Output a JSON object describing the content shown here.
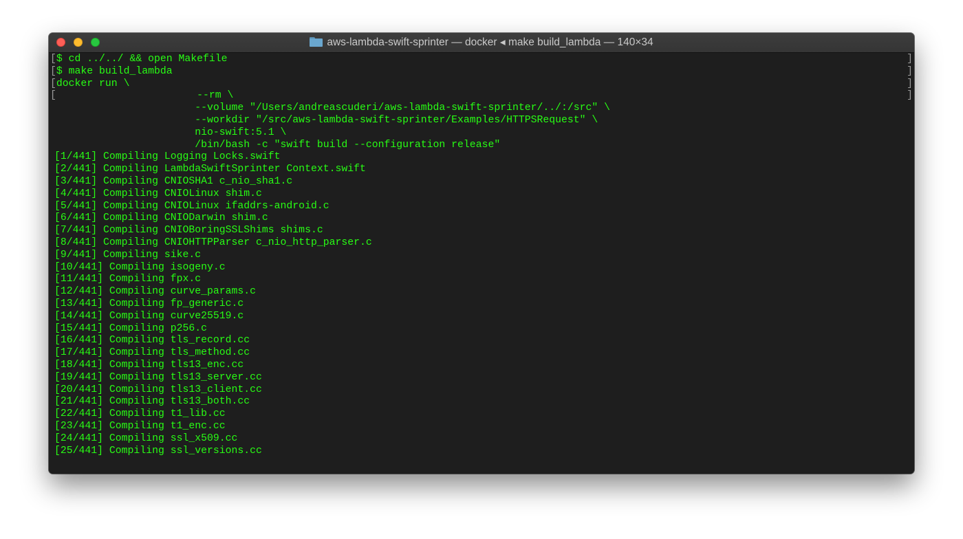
{
  "window": {
    "title": "aws-lambda-swift-sprinter — docker ◂ make build_lambda — 140×34",
    "folder_icon": "folder-icon",
    "colors": {
      "terminal_text": "#28fe14",
      "terminal_background": "#1e1e1e",
      "close": "#fe5f57",
      "minimize": "#febc2e",
      "maximize": "#28c840"
    }
  },
  "terminal": {
    "lines": [
      {
        "text": "$ cd ../../ && open Makefile",
        "bracket": true
      },
      {
        "text": "$ make build_lambda",
        "bracket": true
      },
      {
        "text": "docker run \\",
        "bracket": true
      },
      {
        "text": "                       --rm \\",
        "bracket": true
      },
      {
        "text": "                       --volume \"/Users/andreascuderi/aws-lambda-swift-sprinter/../:/src\" \\",
        "bracket": false
      },
      {
        "text": "                       --workdir \"/src/aws-lambda-swift-sprinter/Examples/HTTPSRequest\" \\",
        "bracket": false
      },
      {
        "text": "                       nio-swift:5.1 \\",
        "bracket": false
      },
      {
        "text": "                       /bin/bash -c \"swift build --configuration release\"",
        "bracket": false
      },
      {
        "text": "[1/441] Compiling Logging Locks.swift",
        "bracket": false
      },
      {
        "text": "[2/441] Compiling LambdaSwiftSprinter Context.swift",
        "bracket": false
      },
      {
        "text": "[3/441] Compiling CNIOSHA1 c_nio_sha1.c",
        "bracket": false
      },
      {
        "text": "[4/441] Compiling CNIOLinux shim.c",
        "bracket": false
      },
      {
        "text": "[5/441] Compiling CNIOLinux ifaddrs-android.c",
        "bracket": false
      },
      {
        "text": "[6/441] Compiling CNIODarwin shim.c",
        "bracket": false
      },
      {
        "text": "[7/441] Compiling CNIOBoringSSLShims shims.c",
        "bracket": false
      },
      {
        "text": "[8/441] Compiling CNIOHTTPParser c_nio_http_parser.c",
        "bracket": false
      },
      {
        "text": "[9/441] Compiling sike.c",
        "bracket": false
      },
      {
        "text": "[10/441] Compiling isogeny.c",
        "bracket": false
      },
      {
        "text": "[11/441] Compiling fpx.c",
        "bracket": false
      },
      {
        "text": "[12/441] Compiling curve_params.c",
        "bracket": false
      },
      {
        "text": "[13/441] Compiling fp_generic.c",
        "bracket": false
      },
      {
        "text": "[14/441] Compiling curve25519.c",
        "bracket": false
      },
      {
        "text": "[15/441] Compiling p256.c",
        "bracket": false
      },
      {
        "text": "[16/441] Compiling tls_record.cc",
        "bracket": false
      },
      {
        "text": "[17/441] Compiling tls_method.cc",
        "bracket": false
      },
      {
        "text": "[18/441] Compiling tls13_enc.cc",
        "bracket": false
      },
      {
        "text": "[19/441] Compiling tls13_server.cc",
        "bracket": false
      },
      {
        "text": "[20/441] Compiling tls13_client.cc",
        "bracket": false
      },
      {
        "text": "[21/441] Compiling tls13_both.cc",
        "bracket": false
      },
      {
        "text": "[22/441] Compiling t1_lib.cc",
        "bracket": false
      },
      {
        "text": "[23/441] Compiling t1_enc.cc",
        "bracket": false
      },
      {
        "text": "[24/441] Compiling ssl_x509.cc",
        "bracket": false
      },
      {
        "text": "[25/441] Compiling ssl_versions.cc",
        "bracket": false
      }
    ]
  }
}
